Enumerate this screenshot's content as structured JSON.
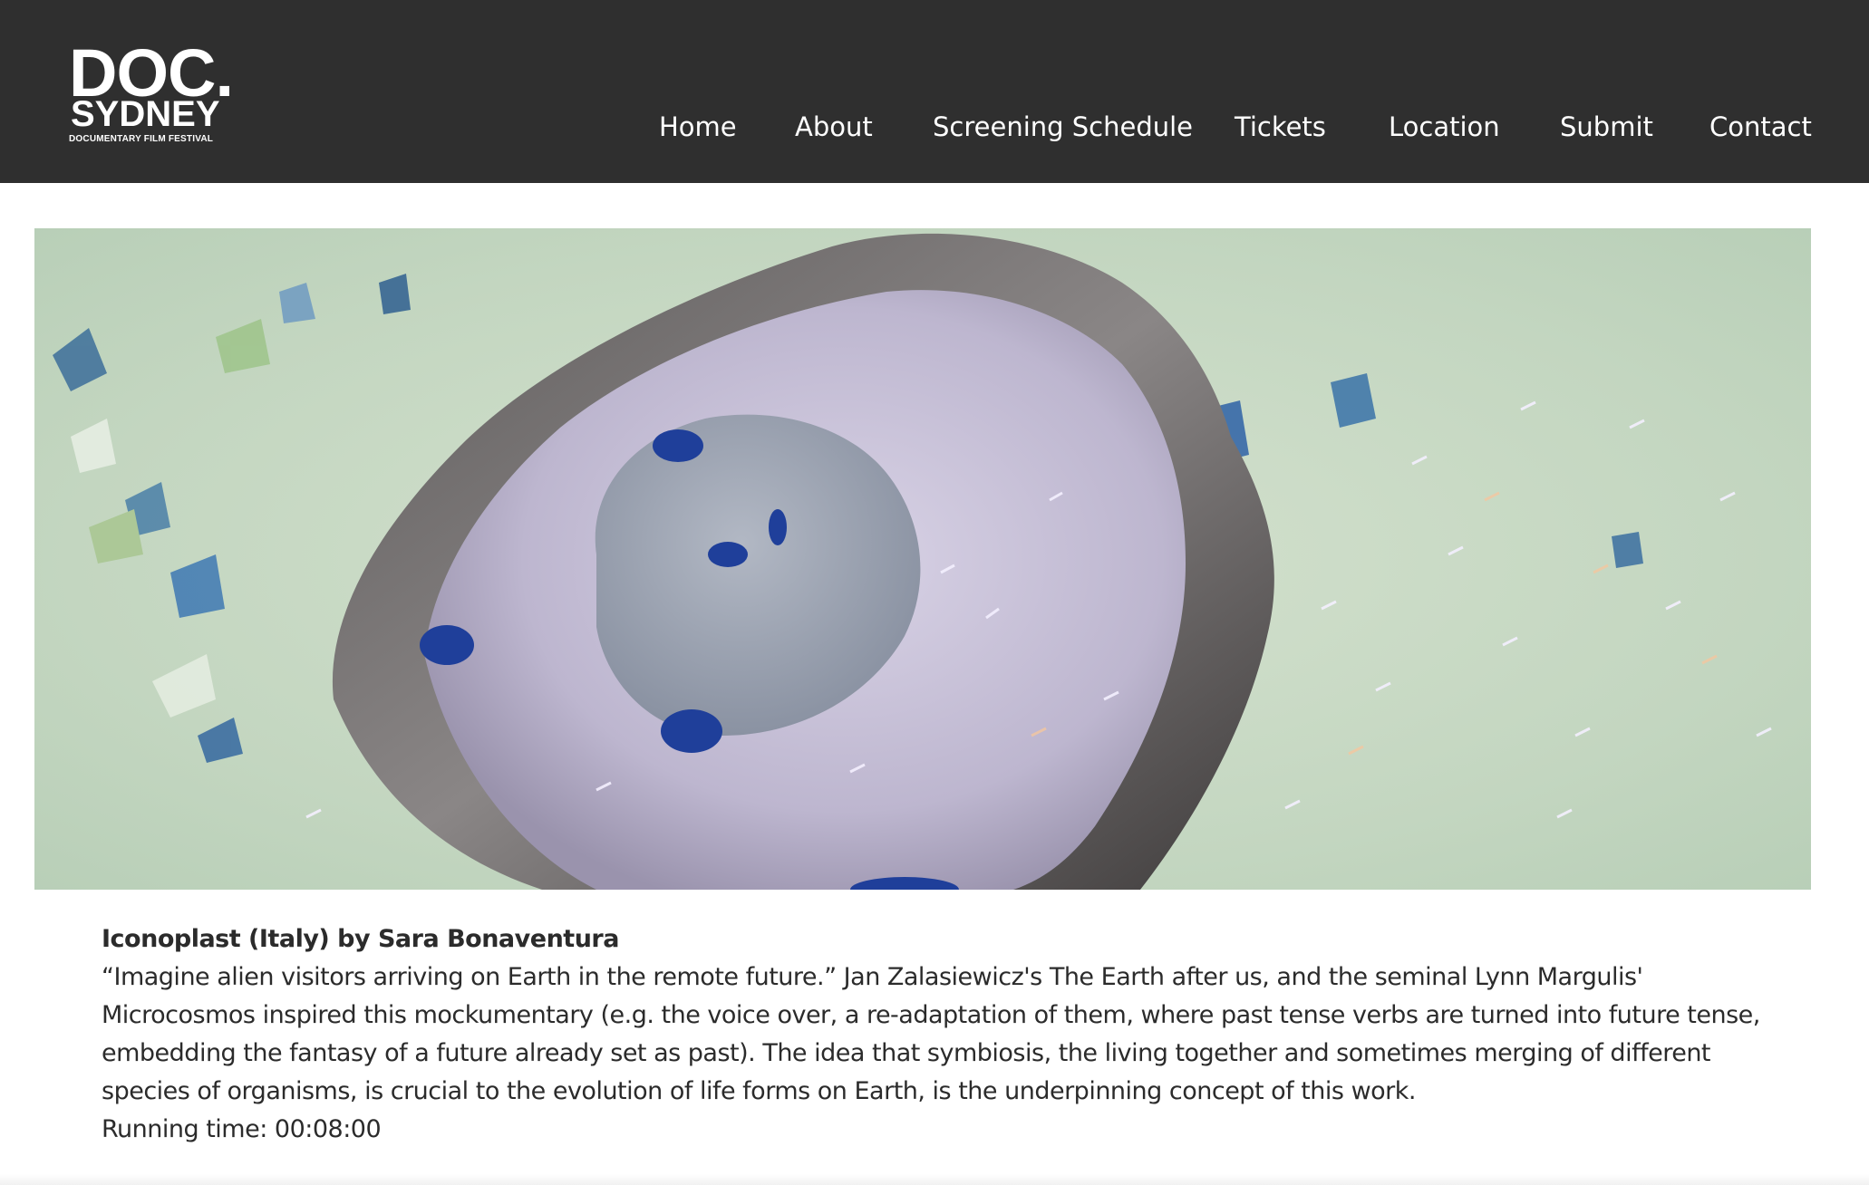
{
  "logo": {
    "line1": "DOC.",
    "line2": "SYDNEY",
    "line3": "DOCUMENTARY FILM FESTIVAL"
  },
  "nav": {
    "items": [
      {
        "label": "Home"
      },
      {
        "label": "About"
      },
      {
        "label": "Screening Schedule"
      },
      {
        "label": "Tickets"
      },
      {
        "label": "Location"
      },
      {
        "label": "Submit"
      },
      {
        "label": "Contact"
      }
    ]
  },
  "film": {
    "title": "Iconoplast (Italy) by Sara Bonaventura",
    "description_lines": [
      "“Imagine alien visitors arriving on Earth in the remote future.”  Jan Zalasiewicz's The Earth after us, and the seminal Lynn Margulis'",
      "Microcosmos inspired this mockumentary (e.g. the voice over, a re-adaptation of them, where past tense verbs are turned into future tense,",
      "embedding the fantasy of a future already set as past).  The idea that symbiosis, the living together and sometimes merging of different",
      "species of organisms, is crucial to the evolution of life forms on Earth, is the underpinning concept of this work."
    ],
    "running_time": "Running time: 00:08:00"
  },
  "colors": {
    "header_bg": "#2f2f2f",
    "header_text": "#ffffff",
    "body_text": "#2b2b2b",
    "page_bg": "#ffffff"
  }
}
